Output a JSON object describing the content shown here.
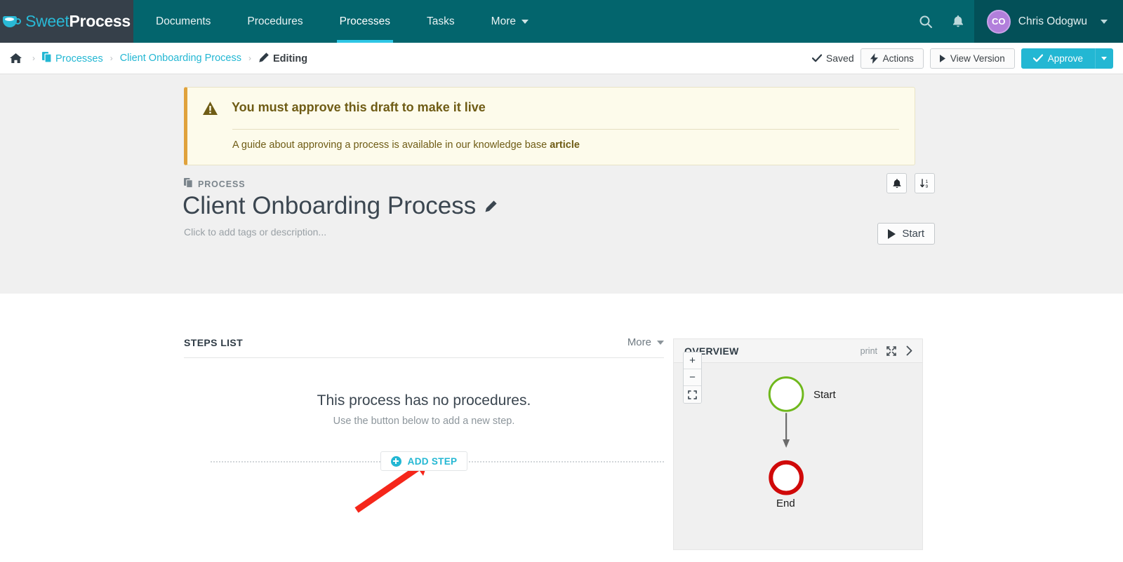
{
  "topnav": {
    "logo": {
      "part1": "Sweet",
      "part2": "Process"
    },
    "items": [
      {
        "label": "Documents",
        "active": false
      },
      {
        "label": "Procedures",
        "active": false
      },
      {
        "label": "Processes",
        "active": true
      },
      {
        "label": "Tasks",
        "active": false
      },
      {
        "label": "More",
        "active": false,
        "has_caret": true
      }
    ],
    "search_icon": "search-icon",
    "bell_icon": "bell-icon",
    "user": {
      "initials": "CO",
      "name": "Chris Odogwu"
    }
  },
  "breadcrumb": {
    "home_icon": "home-icon",
    "items": [
      {
        "label": "Processes",
        "type": "link",
        "icon": "documents-icon"
      },
      {
        "label": "Client Onboarding Process",
        "type": "link"
      },
      {
        "label": "Editing",
        "type": "current",
        "icon": "pencil-icon"
      }
    ],
    "separator": "›"
  },
  "actions": {
    "saved_label": "Saved",
    "saved_icon": "check-icon",
    "buttons": [
      {
        "label": "Actions",
        "icon": "bolt-icon"
      },
      {
        "label": "View Version",
        "icon": "play-small-icon"
      }
    ],
    "approve_label": "Approve",
    "approve_icon": "check-icon",
    "approve_color": "#23b7d3"
  },
  "alert": {
    "icon": "warning-triangle-icon",
    "title": "You must approve this draft to make it live",
    "body_prefix": "A guide about approving a process is available in our knowledge base ",
    "body_link": "article",
    "accent_color": "#e0a23c",
    "background": "#fdfbeb"
  },
  "process": {
    "kicker": "PROCESS",
    "kicker_icon": "documents-icon",
    "title": "Client Onboarding Process",
    "edit_icon": "pencil-icon",
    "placeholder": "Click to add tags or description...",
    "icon_buttons": [
      {
        "name": "notification-bell-button",
        "icon": "bell-icon"
      },
      {
        "name": "sort-order-button",
        "icon": "sort-numeric-icon"
      }
    ],
    "start_label": "Start",
    "start_icon": "play-icon"
  },
  "steps": {
    "panel_title": "STEPS LIST",
    "more_label": "More",
    "empty_title": "This process has no procedures.",
    "empty_sub": "Use the button below to add a new step.",
    "add_step_label": "ADD STEP",
    "add_step_icon": "plus-circle-icon",
    "add_step_color": "#23b7d3"
  },
  "overview": {
    "panel_title": "OVERVIEW",
    "print_label": "print",
    "expand_icon": "expand-arrows-icon",
    "collapse_icon": "chevron-right-icon",
    "zoom_in": "+",
    "zoom_out": "−",
    "fit_icon": "fit-screen-icon",
    "diagram": {
      "nodes": [
        {
          "id": "start",
          "label": "Start",
          "shape": "circle",
          "border_color": "#6fb81c",
          "fill": "#ffffff",
          "border_width": 3
        },
        {
          "id": "end",
          "label": "End",
          "shape": "circle",
          "border_color": "#d00909",
          "fill": "#ffffff",
          "border_width": 6
        }
      ],
      "edges": [
        {
          "from": "start",
          "to": "end",
          "color": "#6b6b6b"
        }
      ]
    }
  },
  "annotation": {
    "type": "arrow",
    "color": "#f5261a",
    "points_to": "ADD STEP"
  }
}
